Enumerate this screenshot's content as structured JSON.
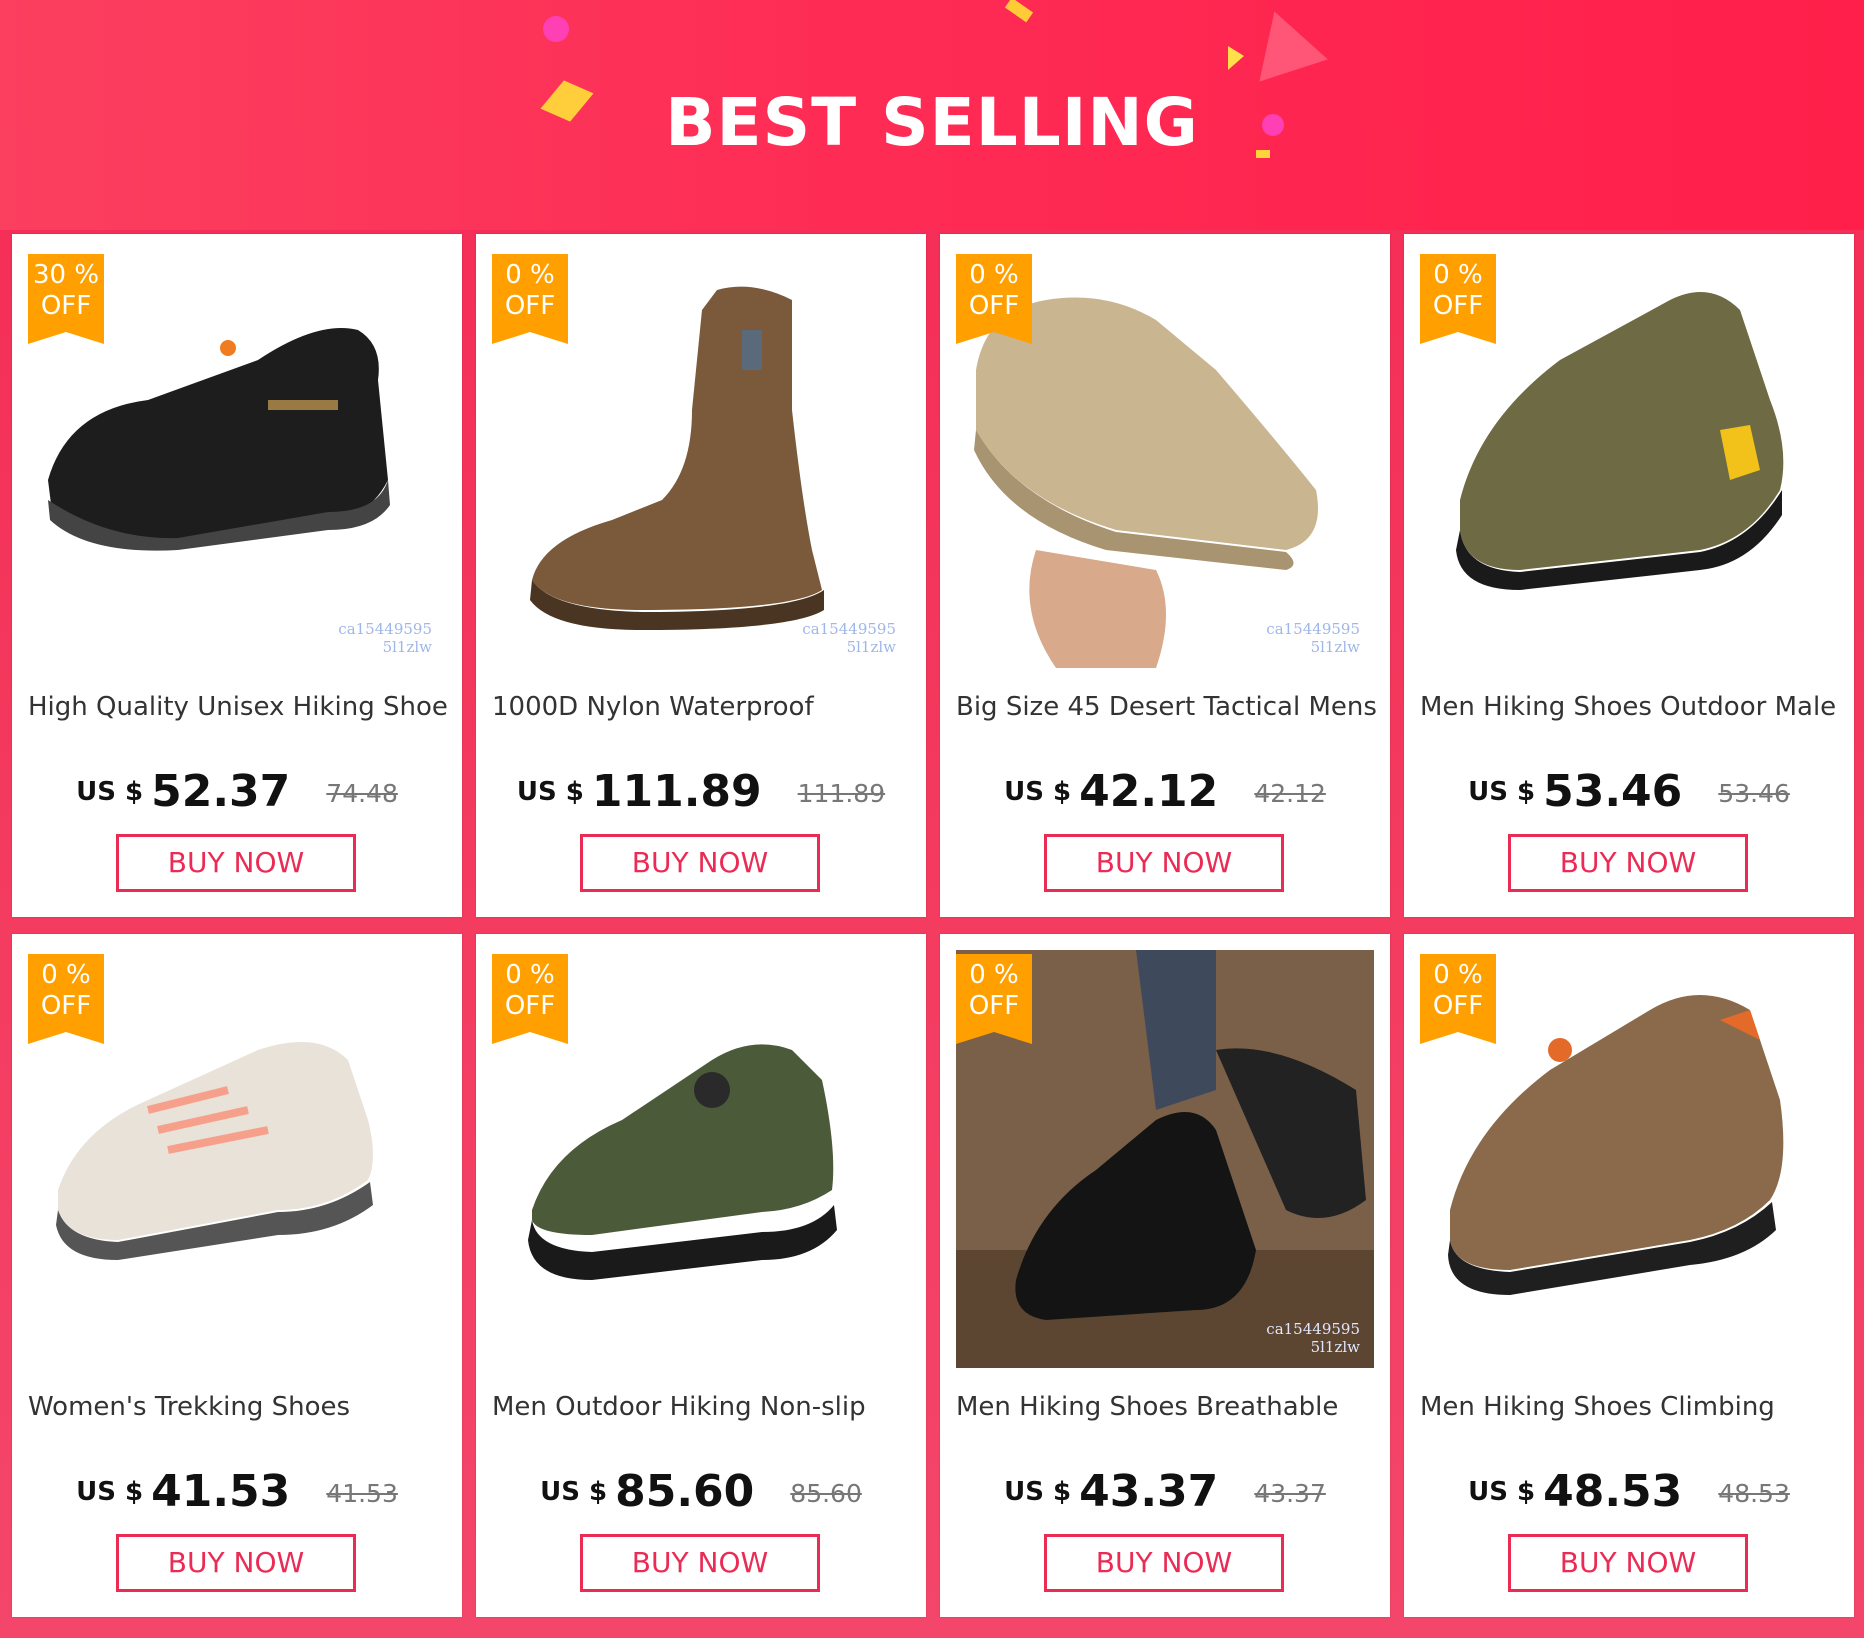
{
  "header": {
    "title": "BEST SELLING"
  },
  "colors": {
    "accent": "#ea2c55",
    "badge": "#ff9f00",
    "header": "#fe2c55"
  },
  "products": [
    {
      "discount": "30 %",
      "off": "OFF",
      "name": "High Quality Unisex Hiking Shoes",
      "currency": "US $",
      "price": "52.37",
      "old_price": "74.48",
      "button": "BUY NOW",
      "watermark": "ca15449595\n5l1zlw",
      "image": "black-leather-hiking-shoe"
    },
    {
      "discount": "0 %",
      "off": "OFF",
      "name": "1000D Nylon Waterproof",
      "currency": "US $",
      "price": "111.89",
      "old_price": "111.89",
      "button": "BUY NOW",
      "watermark": "ca15449595\n5l1zlw",
      "image": "brown-tactical-boot"
    },
    {
      "discount": "0 %",
      "off": "OFF",
      "name": "Big Size 45 Desert Tactical Mens",
      "currency": "US $",
      "price": "42.12",
      "old_price": "42.12",
      "button": "BUY NOW",
      "watermark": "ca15449595\n5l1zlw",
      "image": "desert-tan-shoe-in-hand"
    },
    {
      "discount": "0 %",
      "off": "OFF",
      "name": "Men Hiking Shoes Outdoor Male",
      "currency": "US $",
      "price": "53.46",
      "old_price": "53.46",
      "button": "BUY NOW",
      "watermark": "",
      "image": "olive-green-hiking-shoe"
    },
    {
      "discount": "0 %",
      "off": "OFF",
      "name": "Women's Trekking Shoes",
      "currency": "US $",
      "price": "41.53",
      "old_price": "41.53",
      "button": "BUY NOW",
      "watermark": "",
      "image": "cream-pink-trekking-shoe"
    },
    {
      "discount": "0 %",
      "off": "OFF",
      "name": "Men Outdoor Hiking Non-slip",
      "currency": "US $",
      "price": "85.60",
      "old_price": "85.60",
      "button": "BUY NOW",
      "watermark": "",
      "image": "army-green-boa-shoe"
    },
    {
      "discount": "0 %",
      "off": "OFF",
      "name": "Men Hiking Shoes Breathable",
      "currency": "US $",
      "price": "43.37",
      "old_price": "43.37",
      "button": "BUY NOW",
      "watermark": "ca15449595\n5l1zlw",
      "image": "black-hiking-boot-outdoors"
    },
    {
      "discount": "0 %",
      "off": "OFF",
      "name": "Men Hiking Shoes Climbing",
      "currency": "US $",
      "price": "48.53",
      "old_price": "48.53",
      "button": "BUY NOW",
      "watermark": "",
      "image": "brown-suede-hiking-shoe"
    }
  ]
}
